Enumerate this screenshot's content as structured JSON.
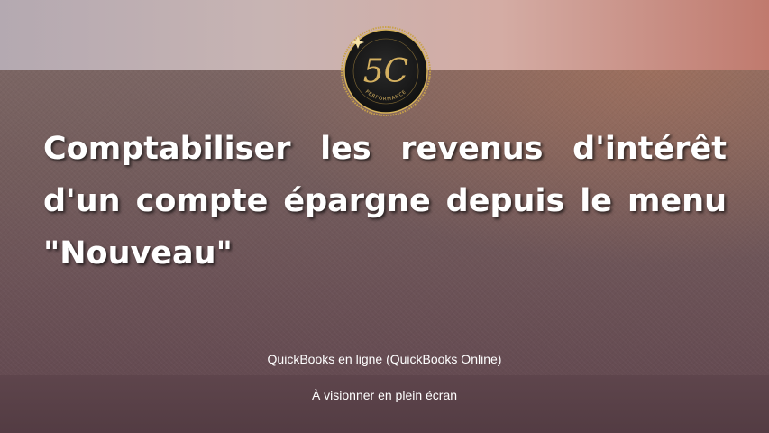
{
  "logo": {
    "monogram": "5C",
    "ring_text": "PERFORMANCE",
    "ring_color": "#c9a24a",
    "disc_color": "#1a1a1a"
  },
  "title": "Comptabiliser les revenus d'intérêt d'un compte épargne depuis le menu \"Nouveau\"",
  "subtitle": "QuickBooks en ligne (QuickBooks Online)",
  "action_label": "À visionner en plein écran"
}
